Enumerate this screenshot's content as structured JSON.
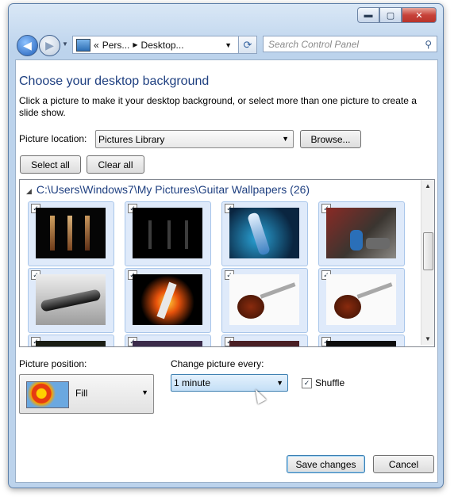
{
  "window": {
    "minimize": "▬",
    "maximize": "▢",
    "close": "✕"
  },
  "nav": {
    "breadcrumb_sep": "«",
    "crumbs": [
      "Pers...",
      "Desktop..."
    ],
    "refresh_icon": "⟳",
    "search_placeholder": "Search Control Panel"
  },
  "page": {
    "title": "Choose your desktop background",
    "description": "Click a picture to make it your desktop background, or select more than one picture to create a slide show.",
    "location_label": "Picture location:",
    "location_value": "Pictures Library",
    "browse": "Browse...",
    "select_all": "Select all",
    "clear_all": "Clear all"
  },
  "gallery": {
    "folder": "C:\\Users\\Windows7\\My Pictures\\Guitar Wallpapers (26)",
    "check": "✓"
  },
  "options": {
    "position_label": "Picture position:",
    "position_value": "Fill",
    "change_label": "Change picture every:",
    "change_value": "1 minute",
    "shuffle_label": "Shuffle",
    "shuffle_checked": "✓"
  },
  "footer": {
    "save": "Save changes",
    "cancel": "Cancel"
  },
  "colors": {
    "accent": "#1e3f80",
    "tile_bg": "#dfeafa",
    "tile_border": "#a9c6ea"
  }
}
